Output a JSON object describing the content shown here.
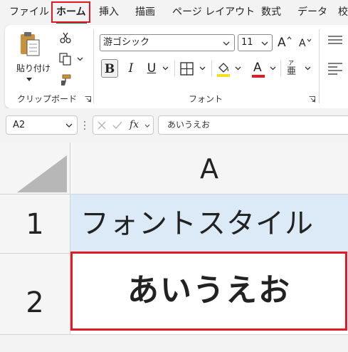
{
  "menu": {
    "tabs": [
      {
        "label": "ファイル"
      },
      {
        "label": "ホーム"
      },
      {
        "label": "挿入"
      },
      {
        "label": "描画"
      },
      {
        "label": "ページ レイアウト"
      },
      {
        "label": "数式"
      },
      {
        "label": "データ"
      },
      {
        "label": "校"
      }
    ],
    "active_tab": "ホーム"
  },
  "ribbon": {
    "clipboard": {
      "paste_label": "貼り付け",
      "group_label": "クリップボード"
    },
    "font": {
      "font_name": "游ゴシック",
      "font_size": "11",
      "grow_label": "A",
      "shrink_label": "A",
      "bold_label": "B",
      "italic_label": "I",
      "underline_label": "U",
      "font_color_label": "A",
      "phonetic_top": "ア",
      "phonetic_bottom": "亜",
      "group_label": "フォント"
    }
  },
  "formula_bar": {
    "name_box": "A2",
    "fx_label": "fx",
    "formula_value": "あいうえお"
  },
  "grid": {
    "column_header": "A",
    "rows": [
      {
        "row_label": "1",
        "cell_value": "フォントスタイル"
      },
      {
        "row_label": "2",
        "cell_value": "あいうえお"
      }
    ]
  },
  "colors": {
    "highlight_red": "#e01b24",
    "active_tab_underline": "#1a6a34",
    "fill_color_bar": "#f5e11b",
    "font_color_bar": "#e01b24",
    "cell_a1_fill": "#dce9f7"
  }
}
